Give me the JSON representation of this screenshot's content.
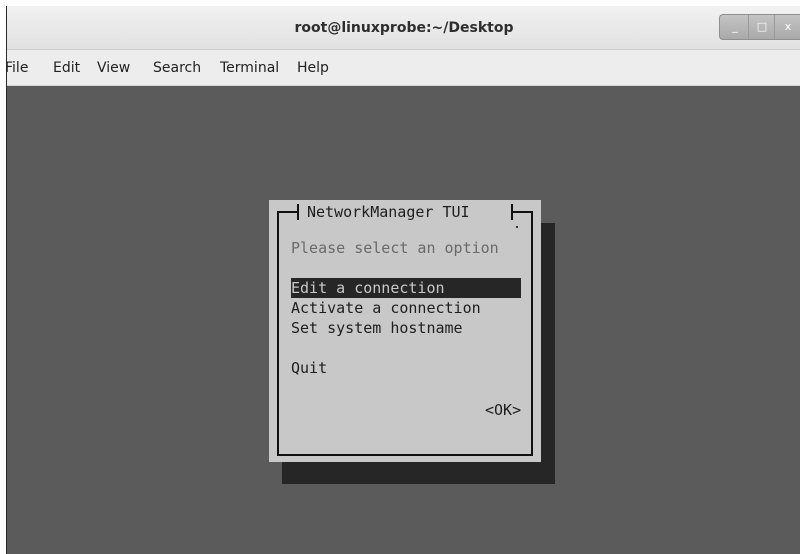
{
  "window": {
    "title": "root@linuxprobe:~/Desktop",
    "controls": {
      "minimize": "_",
      "maximize": "□",
      "close": "x"
    }
  },
  "menubar": {
    "items": [
      {
        "label": "File"
      },
      {
        "label": "Edit"
      },
      {
        "label": "View"
      },
      {
        "label": "Search"
      },
      {
        "label": "Terminal"
      },
      {
        "label": "Help"
      }
    ]
  },
  "dialog": {
    "title": "NetworkManager TUI",
    "prompt": "Please select an option",
    "options": [
      {
        "label": "Edit a connection",
        "selected": true
      },
      {
        "label": "Activate a connection",
        "selected": false
      },
      {
        "label": "Set system hostname",
        "selected": false
      },
      {
        "label": "Quit",
        "selected": false
      }
    ],
    "ok_label": "<OK>"
  },
  "colors": {
    "terminal_bg": "#5b5b5b",
    "dialog_bg": "#c8c8c8",
    "selection_bg": "#262626"
  }
}
